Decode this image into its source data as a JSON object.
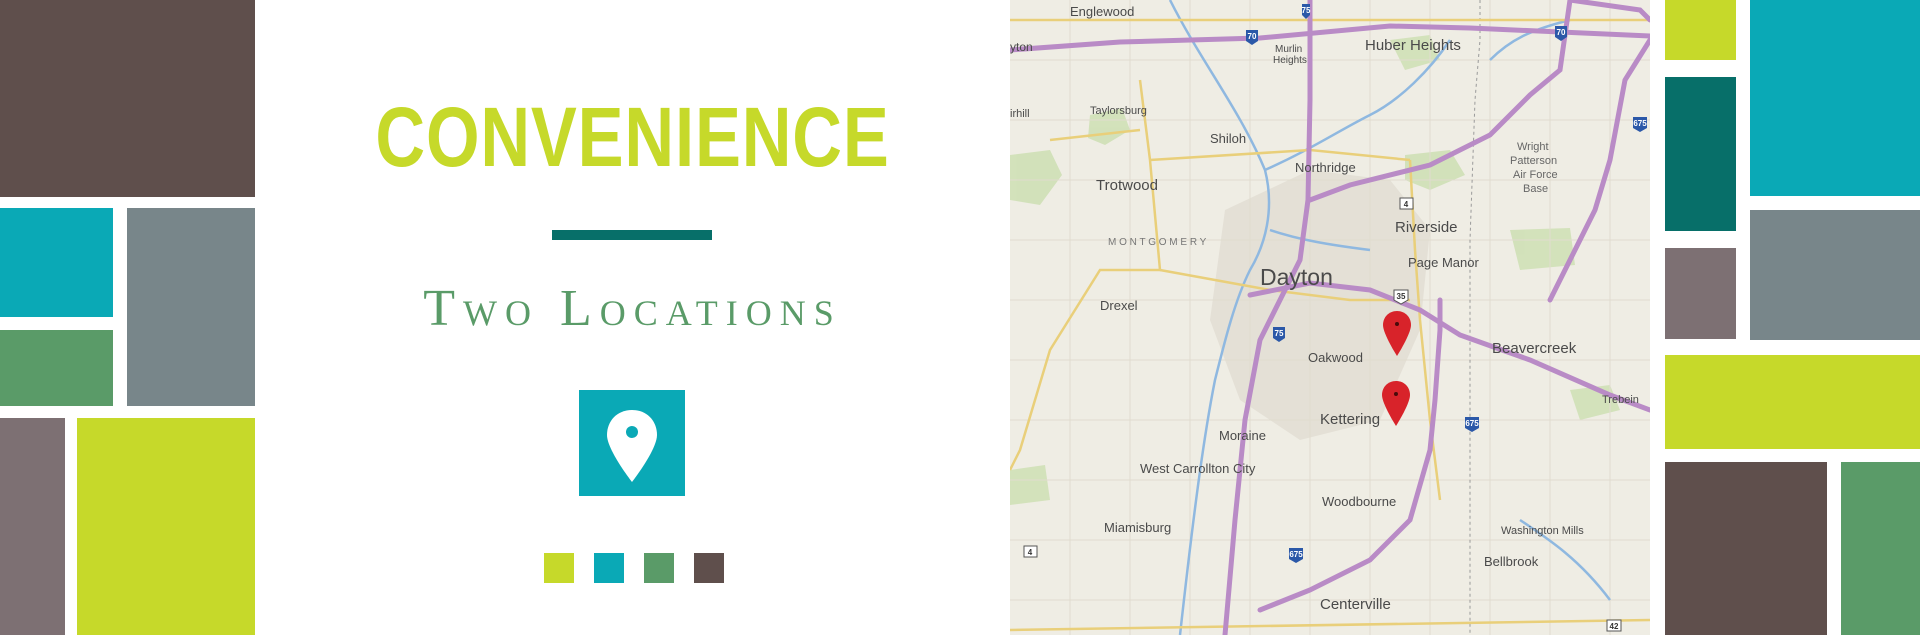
{
  "colors": {
    "lime": "#c6d92a",
    "teal": "#0aa9b6",
    "dark_teal": "#076f69",
    "green": "#5a9b68",
    "brown": "#5f4f4c",
    "slate": "#78868a",
    "mauve": "#7d7073",
    "map_bg": "#efede4",
    "highway": "#b98bc6",
    "marker_red": "#d8232a"
  },
  "headline": "CONVENIENCE",
  "subheadline": "Two Locations",
  "icons": {
    "location": "map-pin-icon",
    "marker": "map-marker-icon"
  },
  "map": {
    "labels": {
      "englewood": "Englewood",
      "huber_heights": "Huber Heights",
      "murlin_heights_1": "Murlin",
      "murlin_heights_2": "Heights",
      "clayton": "yton",
      "airhill": "irhill",
      "taylorsburg": "Taylorsburg",
      "shiloh": "Shiloh",
      "northridge": "Northridge",
      "trotwood": "Trotwood",
      "montgomery": "M O N T G O M E R Y",
      "riverside": "Riverside",
      "wright_1": "Wright",
      "wright_2": "Patterson",
      "wright_3": "Air Force",
      "wright_4": "Base",
      "dayton": "Dayton",
      "page_manor": "Page Manor",
      "drexel": "Drexel",
      "oakwood": "Oakwood",
      "beavercreek": "Beavercreek",
      "trebein": "Trebein",
      "kettering": "Kettering",
      "moraine": "Moraine",
      "west_carrollton": "West Carrollton City",
      "woodbourne": "Woodbourne",
      "miamisburg": "Miamisburg",
      "washington_mills": "Washington Mills",
      "bellbrook": "Bellbrook",
      "centerville": "Centerville"
    },
    "shields": {
      "i75_top": "75",
      "i70_left": "70",
      "i70_right": "70",
      "i675_top": "675",
      "sr4": "4",
      "us35": "35",
      "i75_mid": "75",
      "i675_mid": "675",
      "sr4_sw": "4",
      "i675_bottom": "675",
      "sr42": "42"
    }
  }
}
